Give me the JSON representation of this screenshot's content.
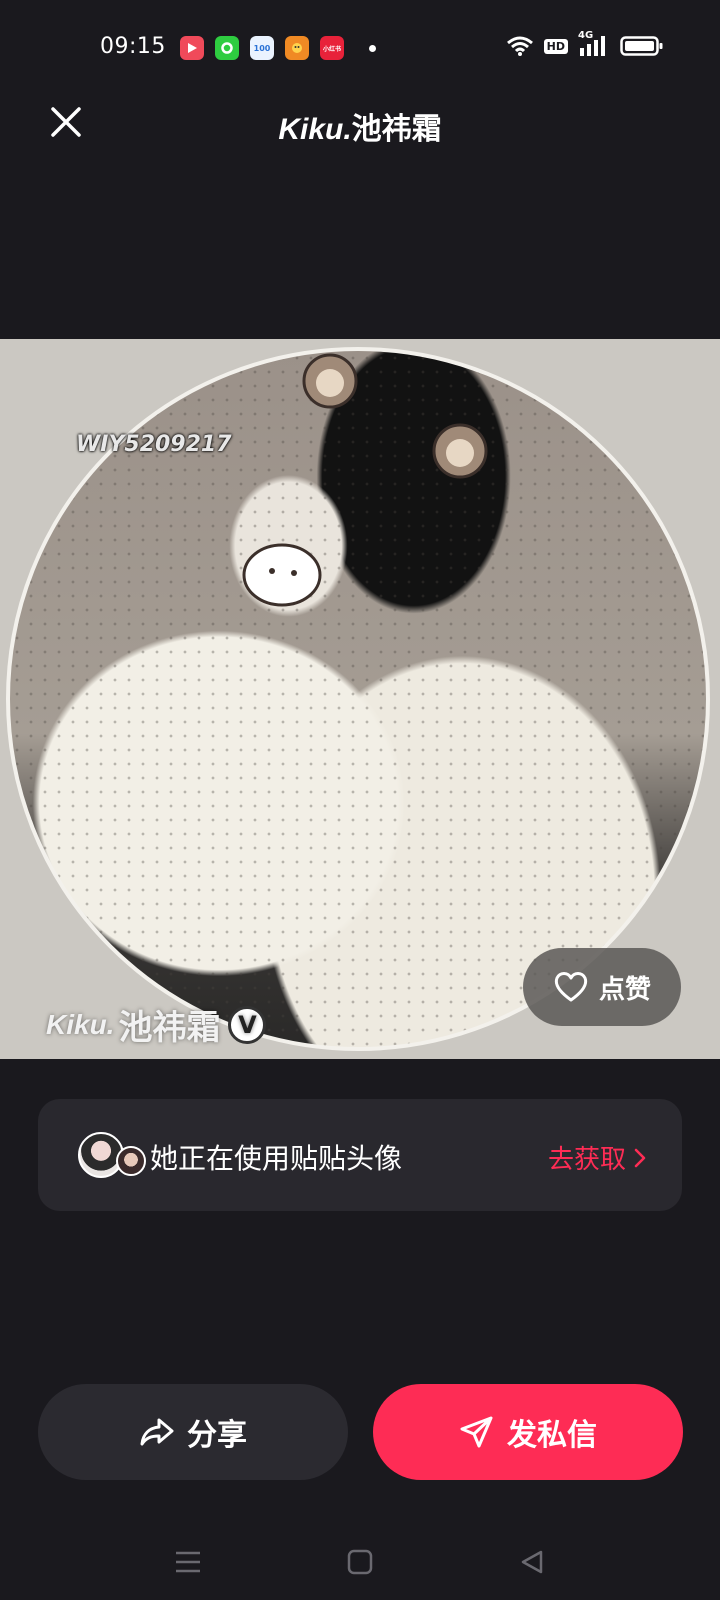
{
  "status_bar": {
    "time": "09:15",
    "app_icons": [
      {
        "name": "video-app-icon",
        "color": "#f04a5a",
        "label": "▶"
      },
      {
        "name": "green-app-icon",
        "color": "#2ecc40",
        "label": "○"
      },
      {
        "name": "app-100-icon",
        "color": "#3a8ee6",
        "label": "100"
      },
      {
        "name": "orange-app-icon",
        "color": "#f08a24",
        "label": "ꗃ"
      },
      {
        "name": "red-app-icon",
        "color": "#e8223a",
        "label": "小红书"
      }
    ],
    "hd_label": "HD",
    "network_label": "4G"
  },
  "header": {
    "title_brand": "Kiku.",
    "title_name": "池祎霜"
  },
  "photo": {
    "watermark_id": "WIY5209217",
    "watermark_brand": "Kiku.",
    "watermark_name": "池祎霜",
    "verified_label": "V",
    "like_label": "点赞"
  },
  "promo": {
    "text": "她正在使用贴贴头像",
    "link_label": "去获取"
  },
  "actions": {
    "share_label": "分享",
    "message_label": "发私信"
  },
  "colors": {
    "background": "#1a191e",
    "accent": "#fe2c55",
    "card": "#29282e"
  }
}
